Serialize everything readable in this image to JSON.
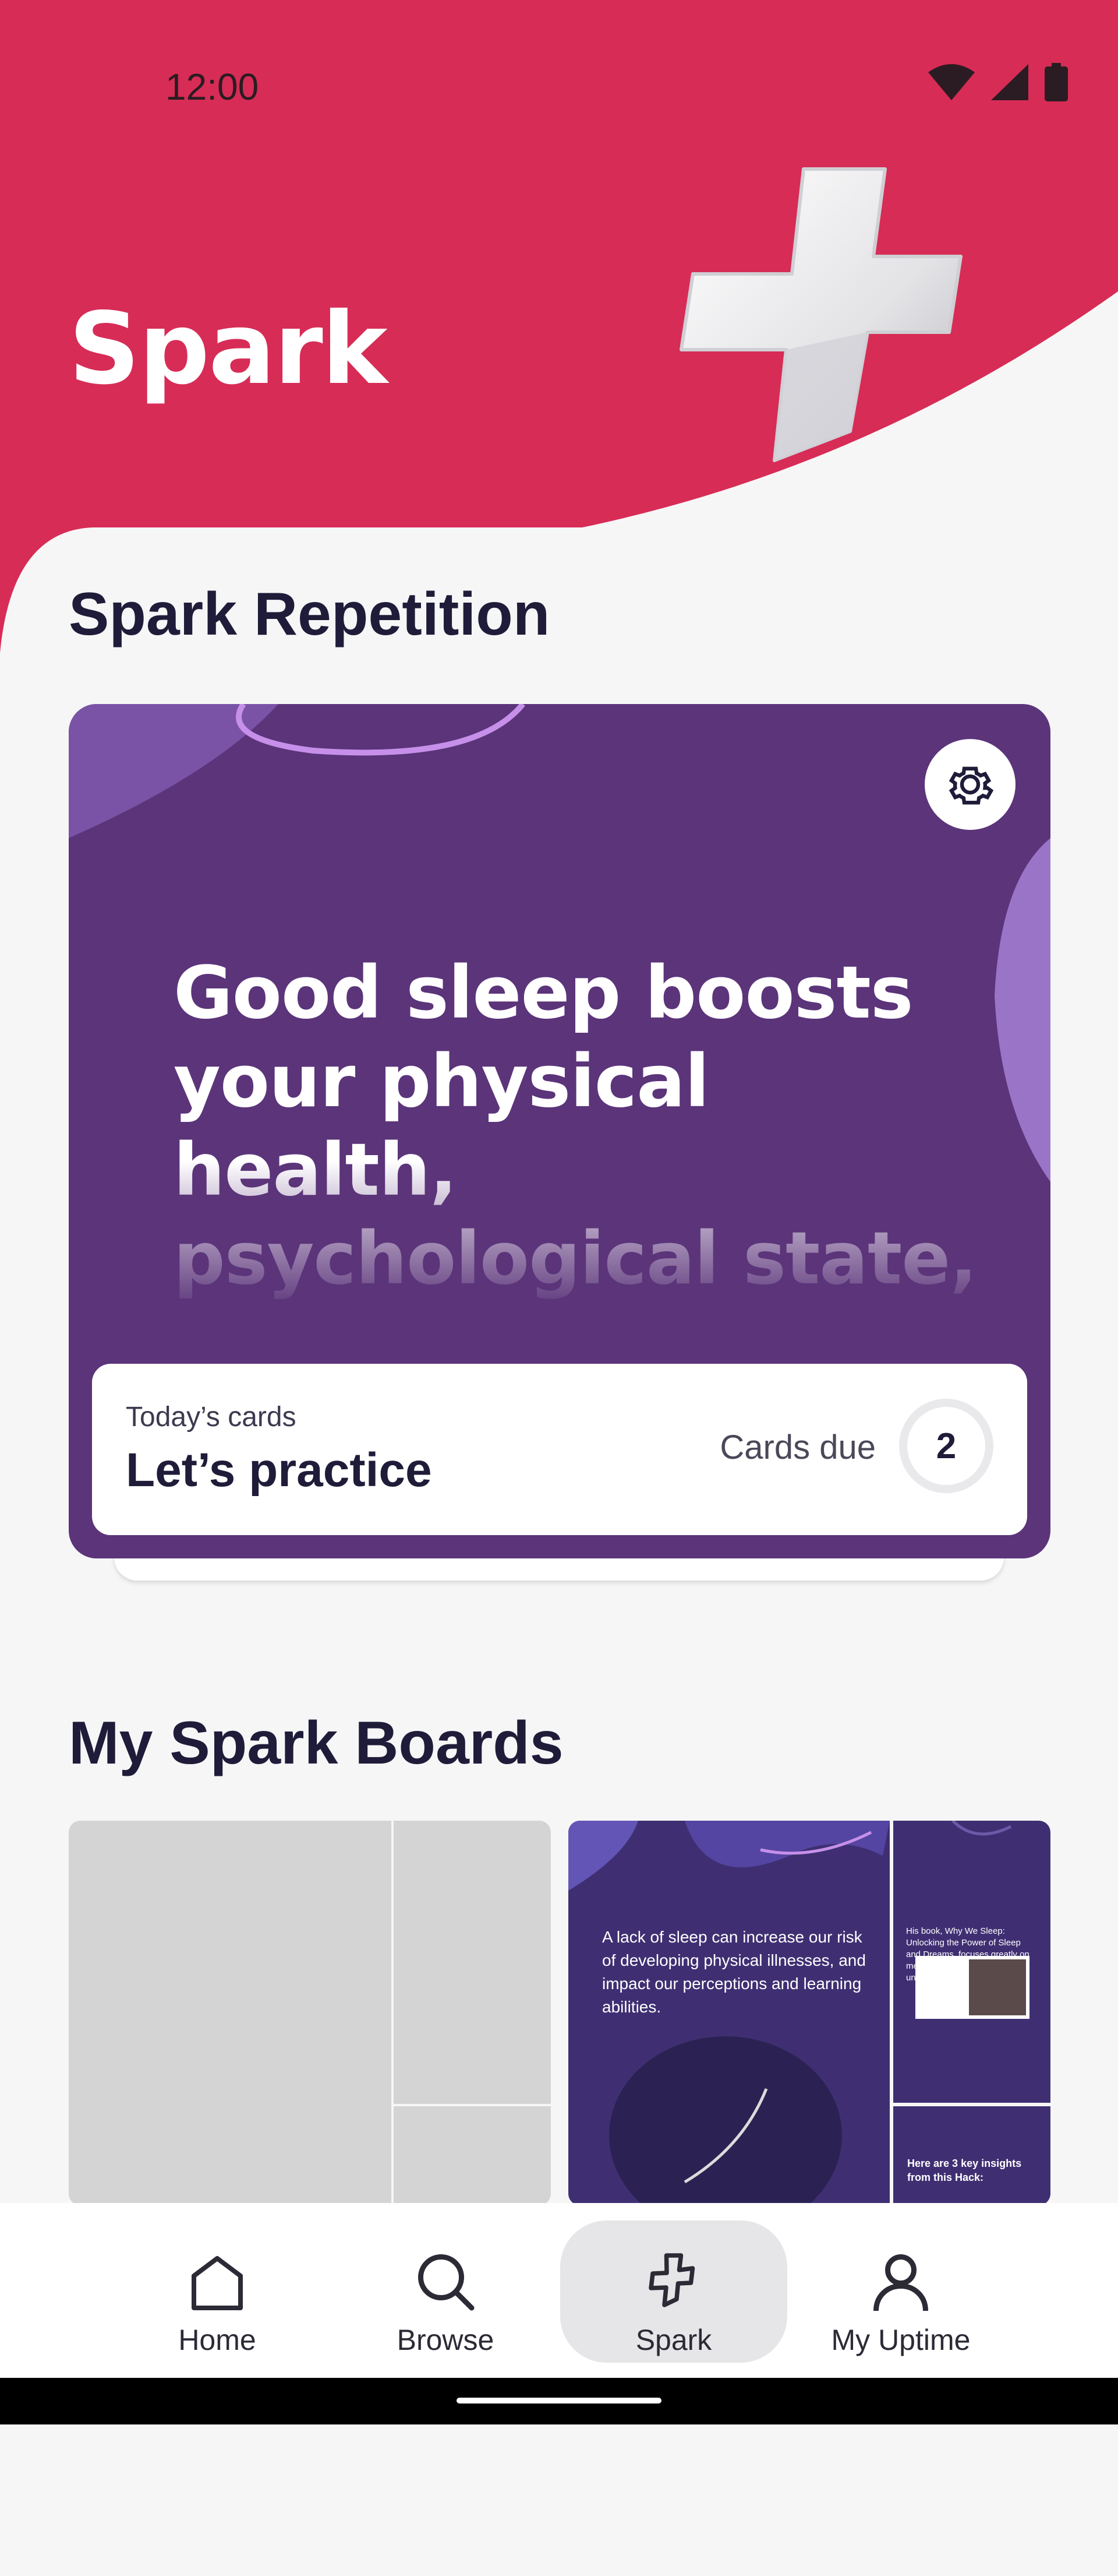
{
  "status_bar": {
    "time": "12:00",
    "icons": [
      "wifi-icon",
      "signal-icon",
      "battery-icon"
    ]
  },
  "header": {
    "title": "Spark",
    "art": "3d-star-icon",
    "background_color": "#d72c56"
  },
  "spark_repetition": {
    "section_title": "Spark Repetition",
    "card": {
      "background_color": "#5b347a",
      "settings_icon": "gear-icon",
      "quote": "Good sleep boosts your physical health, psychological state, and creativity",
      "subtitle": "Today’s cards",
      "action": "Let’s practice",
      "cards_due_label": "Cards due",
      "cards_due_count": "2"
    }
  },
  "boards": {
    "section_title": "My Spark Boards",
    "items": [
      {
        "type": "empty"
      },
      {
        "type": "sleep",
        "main_text": "A lack of sleep can increase our risk of developing physical illnesses, and impact our perceptions and learning abilities.",
        "side_text": "His book, Why We Sleep: Unlocking the Power of Sleep and Dreams, focuses greatly on mental health and the understanding of human sleep.",
        "insights_text": "Here are 3 key insights from this Hack:"
      }
    ]
  },
  "bottom_nav": {
    "items": [
      {
        "label": "Home",
        "icon": "home-icon",
        "active": false
      },
      {
        "label": "Browse",
        "icon": "search-icon",
        "active": false
      },
      {
        "label": "Spark",
        "icon": "star-icon",
        "active": true
      },
      {
        "label": "My Uptime",
        "icon": "person-icon",
        "active": false
      }
    ]
  }
}
